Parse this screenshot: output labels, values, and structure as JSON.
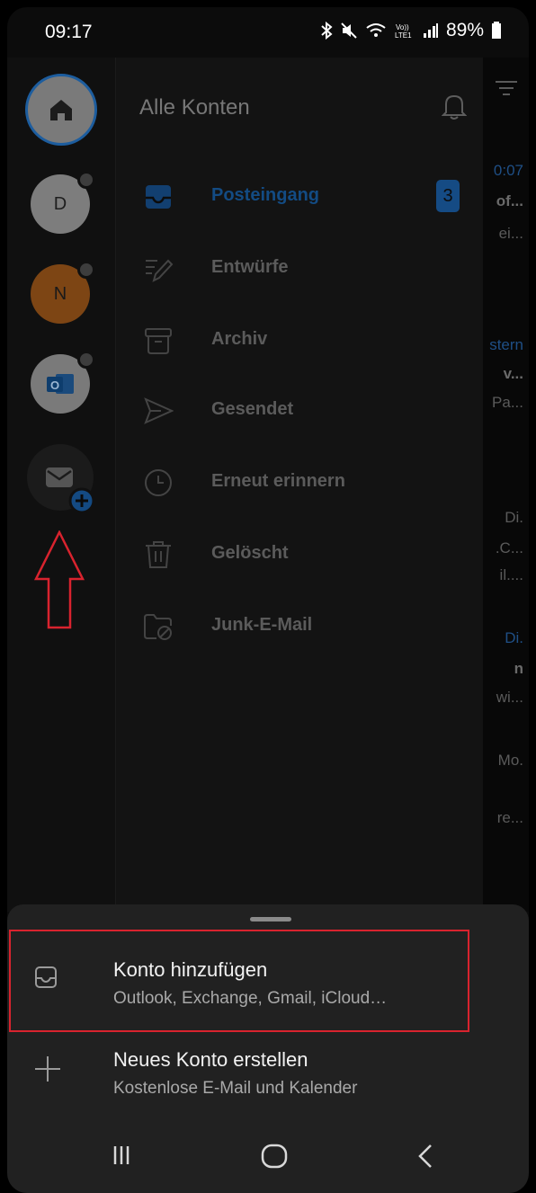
{
  "status_bar": {
    "time": "09:17",
    "battery": "89%",
    "icons": [
      "bluetooth-icon",
      "mute-icon",
      "wifi-calling-icon",
      "volte-icon",
      "signal-icon",
      "battery-icon"
    ]
  },
  "drawer": {
    "title": "Alle Konten",
    "folders": [
      {
        "label": "Posteingang",
        "icon": "inbox-icon",
        "badge": "3",
        "active": true
      },
      {
        "label": "Entwürfe",
        "icon": "drafts-icon"
      },
      {
        "label": "Archiv",
        "icon": "archive-icon"
      },
      {
        "label": "Gesendet",
        "icon": "sent-icon"
      },
      {
        "label": "Erneut erinnern",
        "icon": "snooze-icon"
      },
      {
        "label": "Gelöscht",
        "icon": "trash-icon"
      },
      {
        "label": "Junk-E-Mail",
        "icon": "junk-icon"
      }
    ]
  },
  "accounts": {
    "items": [
      {
        "type": "home",
        "icon": "home-icon"
      },
      {
        "type": "letter",
        "initial": "D"
      },
      {
        "type": "letter",
        "initial": "N"
      },
      {
        "type": "outlook",
        "icon": "outlook-icon"
      },
      {
        "type": "add",
        "icon": "add-account-icon"
      }
    ]
  },
  "mail_preview": {
    "snippets": [
      "0:07",
      "of...",
      "ei...",
      "stern",
      "v...",
      "Pa...",
      "Di.",
      ".C...",
      "il....",
      "Di.",
      "n",
      "wi...",
      "Mo.",
      "re..."
    ]
  },
  "sheet": {
    "options": [
      {
        "title": "Konto hinzufügen",
        "subtitle": "Outlook, Exchange, Gmail, iCloud…",
        "icon": "inbox-tray-icon"
      },
      {
        "title": "Neues Konto erstellen",
        "subtitle": "Kostenlose E-Mail und Kalender",
        "icon": "plus-icon"
      }
    ]
  },
  "nav": {
    "buttons": [
      "recent-apps-icon",
      "home-nav-icon",
      "back-icon"
    ]
  },
  "colors": {
    "accent": "#1565c0",
    "highlight": "#d9232e",
    "sheet": "#212121"
  }
}
